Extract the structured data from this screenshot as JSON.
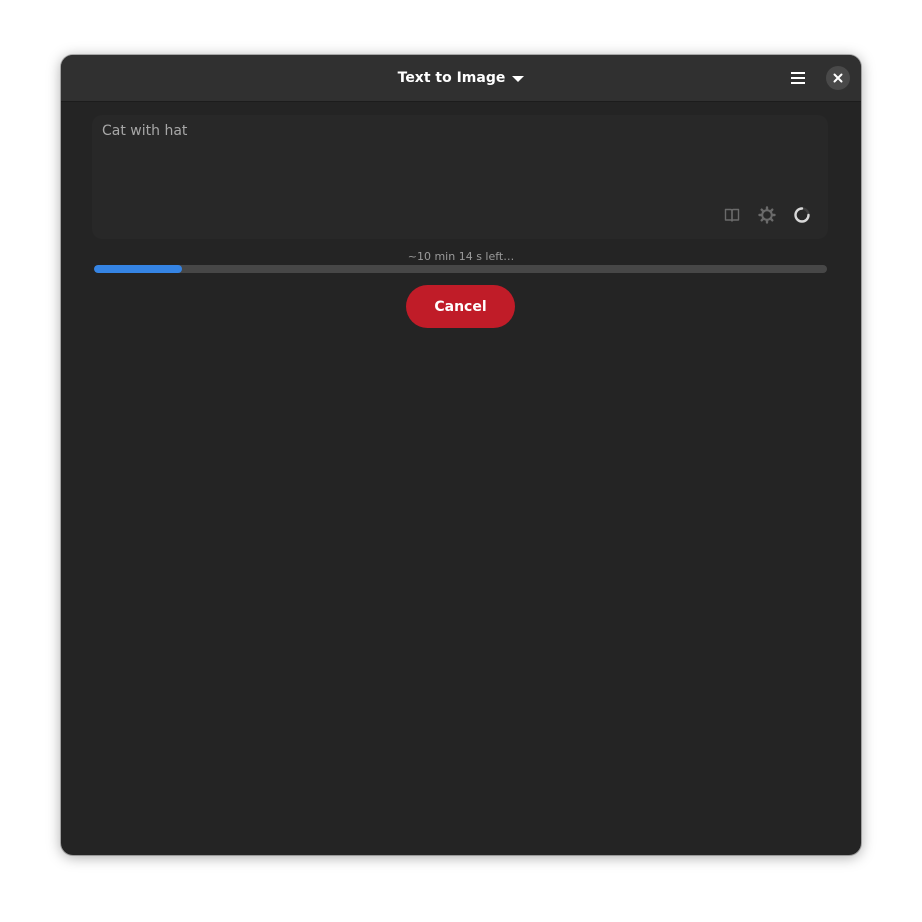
{
  "header": {
    "title": "Text to Image",
    "menu_icon": "hamburger-menu-icon",
    "close_icon": "close-icon"
  },
  "prompt": {
    "text": "Cat with hat",
    "icons": [
      "book-icon",
      "gear-icon",
      "spinner-icon"
    ]
  },
  "progress": {
    "label": "~10 min 14 s left…",
    "fraction": 0.12
  },
  "actions": {
    "cancel_label": "Cancel"
  },
  "colors": {
    "accent": "#3584e4",
    "destructive": "#c01c28",
    "window_bg": "#242424",
    "header_bg": "#303030"
  }
}
